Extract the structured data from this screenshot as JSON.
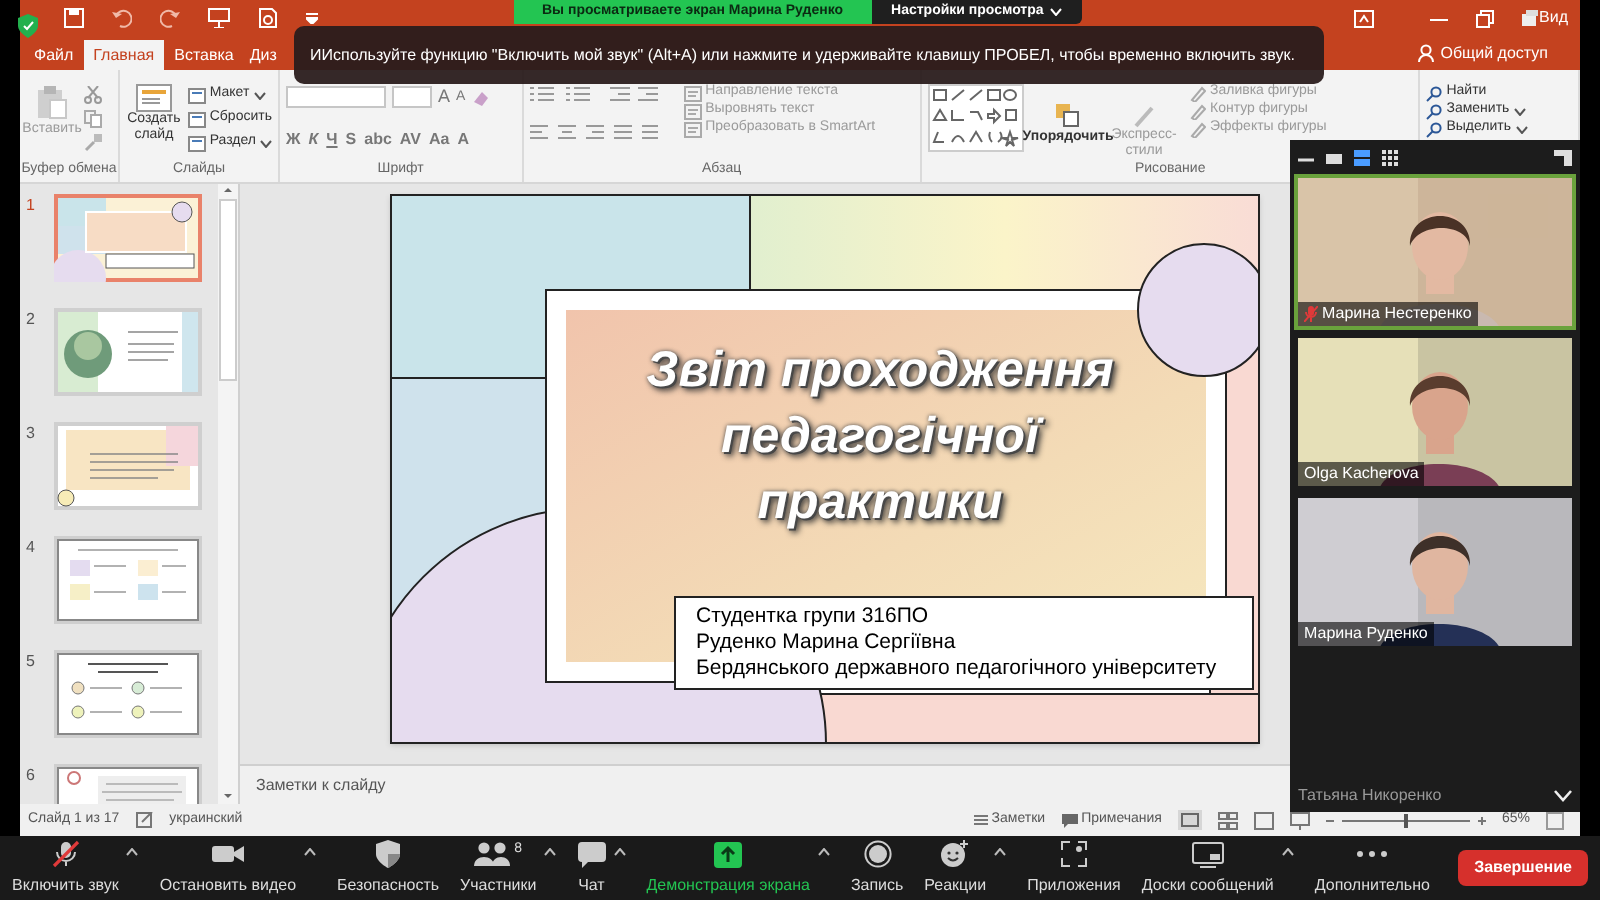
{
  "zoom_banner": {
    "viewing_text": "Вы просматриваете экран Марина Руденко",
    "view_options": "Настройки просмотра"
  },
  "tooltip": "ИИспользуйте функцию \"Включить мой звук\" (Alt+A) или нажмите и удерживайте клавишу ПРОБЕЛ, чтобы временно включить звук.",
  "title_bar": {
    "view_label": "Вид"
  },
  "ribbon_tabs": [
    {
      "label": "Файл",
      "selected": false
    },
    {
      "label": "Главная",
      "selected": true
    },
    {
      "label": "Вставка",
      "selected": false
    },
    {
      "label": "Диз",
      "selected": false
    }
  ],
  "share_button": "Общий доступ",
  "ribbon_groups": [
    {
      "kind": "clipboard",
      "label": "Буфер обмена",
      "paste": {
        "label": "Вставить",
        "disabled": true
      }
    },
    {
      "kind": "slides",
      "label": "Слайды",
      "new_slide": "Создать слайд",
      "items": [
        {
          "label": "Макет",
          "dropdown": true
        },
        {
          "label": "Сбросить",
          "dropdown": false
        },
        {
          "label": "Раздел",
          "dropdown": true
        }
      ]
    },
    {
      "kind": "font",
      "label": "Шрифт",
      "size_buttons": [
        "A",
        "A"
      ],
      "format_buttons": [
        "Ж",
        "К",
        "Ч",
        "S",
        "abc",
        "AV",
        "Aa",
        "A"
      ]
    },
    {
      "kind": "paragraph",
      "label": "Абзац",
      "items": [
        {
          "label": "Направление текста",
          "disabled": true
        },
        {
          "label": "Выровнять текст",
          "disabled": true
        },
        {
          "label": "Преобразовать в SmartArt",
          "disabled": true
        }
      ]
    },
    {
      "kind": "drawing",
      "label": "Рисование",
      "arrange": "Упорядочить",
      "quick_styles": {
        "label": "Экспресс-стили",
        "disabled": true
      },
      "items": [
        {
          "label": "Заливка фигуры",
          "disabled": true
        },
        {
          "label": "Контур фигуры",
          "disabled": true
        },
        {
          "label": "Эффекты фигуры",
          "disabled": true
        }
      ]
    },
    {
      "kind": "editing",
      "items": [
        {
          "label": "Найти",
          "dropdown": false
        },
        {
          "label": "Заменить",
          "dropdown": true
        },
        {
          "label": "Выделить",
          "dropdown": true
        }
      ]
    }
  ],
  "thumbnails": [
    {
      "number": "1",
      "selected": true
    },
    {
      "number": "2",
      "selected": false
    },
    {
      "number": "3",
      "selected": false
    },
    {
      "number": "4",
      "selected": false
    },
    {
      "number": "5",
      "selected": false
    },
    {
      "number": "6",
      "selected": false
    }
  ],
  "slide": {
    "title": "Звіт проходження педагогічної практики",
    "subtitle_lines": [
      "Студентка групи 316ПО",
      "Руденко Марина Сергіївна",
      "Бердянського державного педагогічного університету"
    ]
  },
  "notes_placeholder": "Заметки к слайду",
  "status_bar": {
    "slide_counter": "Слайд 1 из 17",
    "language": "украинский",
    "notes": "Заметки",
    "comments": "Примечания",
    "zoom": "65%",
    "zoom_slider": {
      "level": 0.5
    }
  },
  "video_panel": {
    "tiles": [
      {
        "name": "Марина Нестеренко",
        "muted": true,
        "speaking": true
      },
      {
        "name": "Olga Kacherova",
        "muted": false,
        "speaking": false
      },
      {
        "name": "Марина Руденко",
        "muted": false,
        "speaking": false
      }
    ],
    "next_name": "Татьяна Никоренко"
  },
  "toolbar": {
    "items": [
      {
        "kind": "audio",
        "label": "Включить звук",
        "muted": true,
        "menu": true
      },
      {
        "kind": "video",
        "label": "Остановить видео",
        "menu": true
      },
      {
        "kind": "security",
        "label": "Безопасность",
        "menu": false
      },
      {
        "kind": "participants",
        "label": "Участники",
        "count": "8",
        "menu": true
      },
      {
        "kind": "chat",
        "label": "Чат",
        "menu": true
      },
      {
        "kind": "share",
        "label": "Демонстрация экрана",
        "menu": true
      },
      {
        "kind": "record",
        "label": "Запись",
        "menu": false
      },
      {
        "kind": "reactions",
        "label": "Реакции",
        "menu": true
      },
      {
        "kind": "apps",
        "label": "Приложения",
        "menu": false
      },
      {
        "kind": "whiteboards",
        "label": "Доски сообщений",
        "menu": true
      },
      {
        "kind": "more",
        "label": "Дополнительно",
        "menu": false
      }
    ],
    "end_button": "Завершение"
  }
}
